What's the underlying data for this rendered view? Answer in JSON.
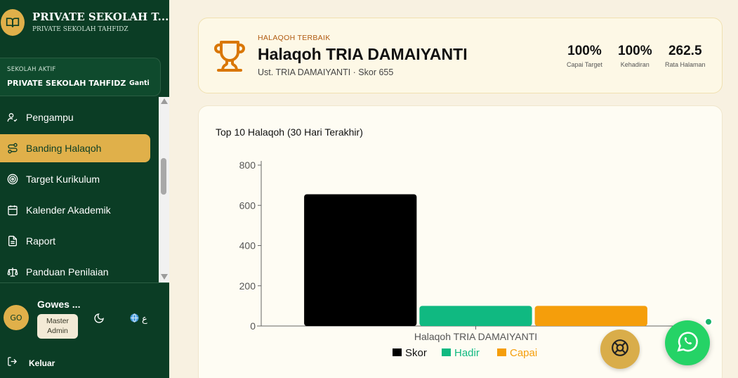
{
  "brand": {
    "title": "PRIVATE SEKOLAH T...",
    "subtitle": "PRIVATE SEKOLAH TAHFIDZ"
  },
  "school": {
    "label": "SEKOLAH AKTIF",
    "name": "PRIVATE SEKOLAH TAHFIDZ",
    "change_label": "Ganti"
  },
  "nav": {
    "items": [
      {
        "label": "Pengampu",
        "icon": "user-check-icon"
      },
      {
        "label": "Banding Halaqoh",
        "icon": "route-icon",
        "active": true
      },
      {
        "label": "Target Kurikulum",
        "icon": "target-icon"
      },
      {
        "label": "Kalender Akademik",
        "icon": "calendar-icon"
      },
      {
        "label": "Raport",
        "icon": "file-text-icon"
      },
      {
        "label": "Panduan Penilaian",
        "icon": "scale-icon"
      }
    ]
  },
  "user": {
    "initials": "GO",
    "name": "Gowes ...",
    "role_line1": "Master",
    "role_line2": "Admin",
    "lang": "ع"
  },
  "logout_label": "Keluar",
  "best": {
    "label": "HALAQOH TERBAIK",
    "name": "Halaqoh TRIA DAMAIYANTI",
    "meta": "Ust. TRIA DAMAIYANTI · Skor 655",
    "stats": [
      {
        "value": "100%",
        "label": "Capai Target"
      },
      {
        "value": "100%",
        "label": "Kehadiran"
      },
      {
        "value": "262.5",
        "label": "Rata Halaman"
      }
    ]
  },
  "colors": {
    "sidebar": "#0b3d25",
    "accent": "#e0b04a",
    "skor": "#000000",
    "hadir": "#10b981",
    "capai": "#f59e0b",
    "trophy": "#d97706"
  },
  "chart_data": {
    "type": "bar",
    "title": "Top 10 Halaqoh (30 Hari Terakhir)",
    "categories": [
      "Halaqoh TRIA DAMAIYANTI"
    ],
    "series": [
      {
        "name": "Skor",
        "values": [
          655
        ],
        "color": "#000000"
      },
      {
        "name": "Hadir",
        "values": [
          100
        ],
        "color": "#10b981"
      },
      {
        "name": "Capai",
        "values": [
          100
        ],
        "color": "#f59e0b"
      }
    ],
    "yticks": [
      0,
      200,
      400,
      600,
      800
    ],
    "ylim": [
      0,
      800
    ],
    "legend": "bottom",
    "grid": false
  }
}
